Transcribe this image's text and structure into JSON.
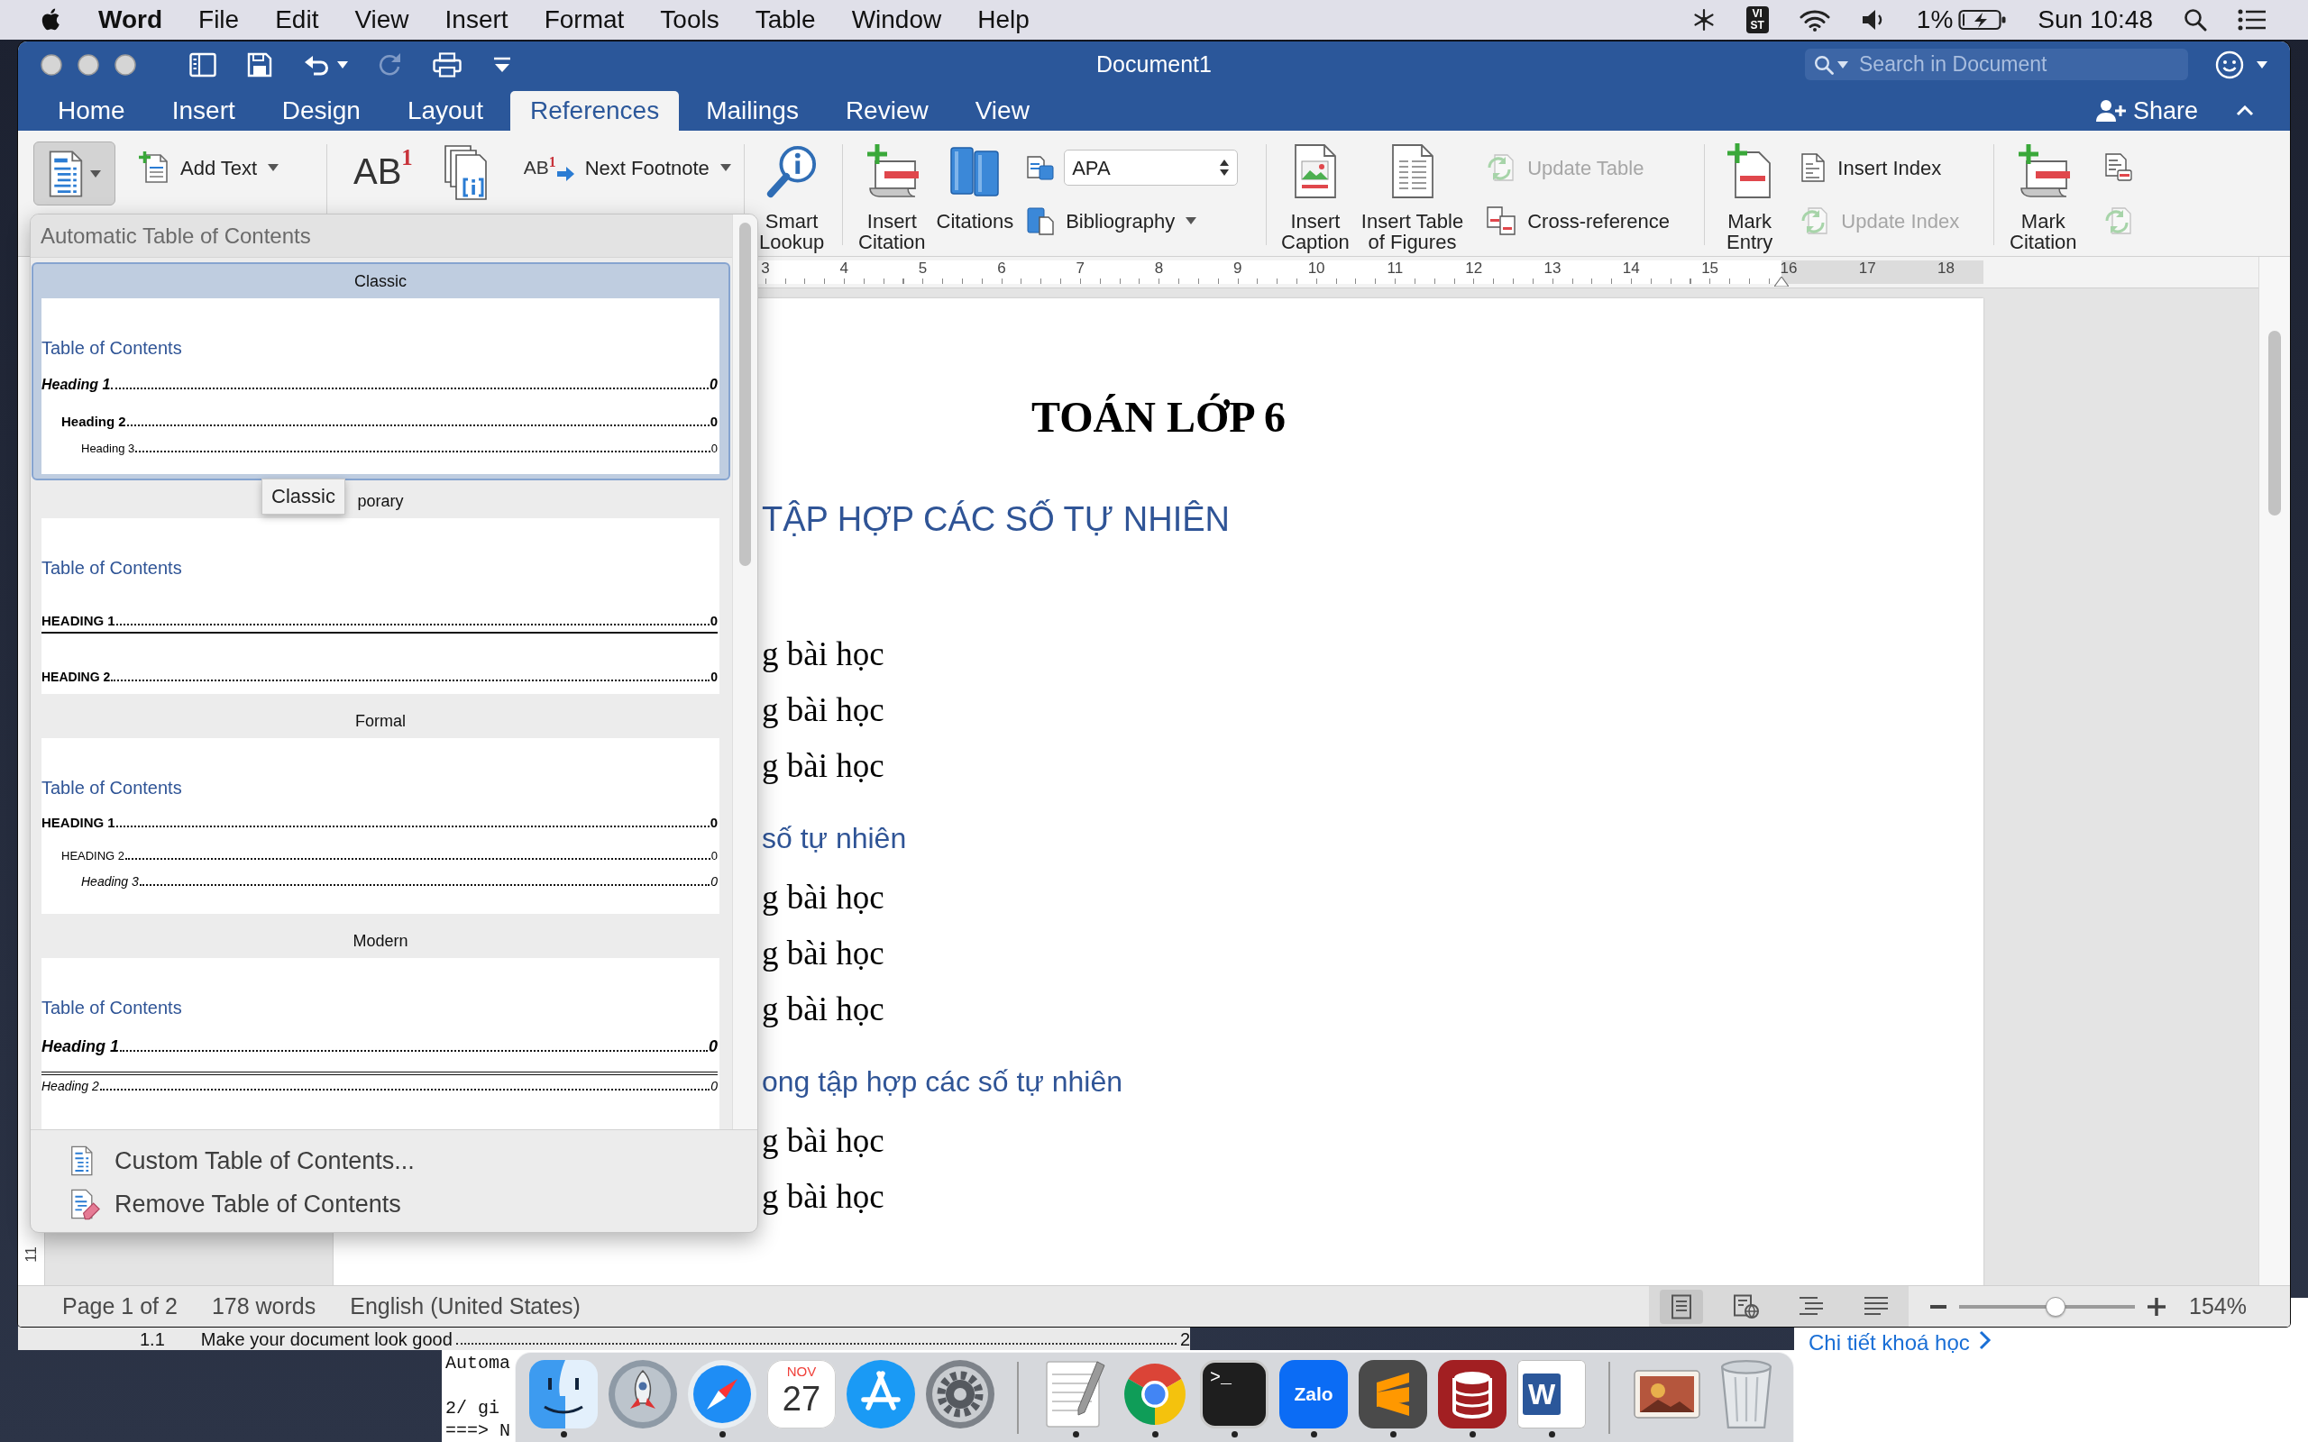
{
  "menu_bar": {
    "app": "Word",
    "items": [
      "File",
      "Edit",
      "View",
      "Insert",
      "Format",
      "Tools",
      "Table",
      "Window",
      "Help"
    ],
    "input_source": "VI\nST",
    "battery": "1%",
    "clock": "Sun 10:48"
  },
  "window": {
    "title": "Document1",
    "toolbar": [
      {
        "kind": "sidebar",
        "disabled": false
      },
      {
        "kind": "save",
        "disabled": false
      },
      {
        "kind": "undo",
        "disabled": false
      },
      {
        "kind": "redo",
        "disabled": true
      },
      {
        "kind": "print",
        "disabled": false
      },
      {
        "kind": "customize",
        "disabled": false
      }
    ],
    "search": {
      "placeholder": "Search in Document"
    },
    "share": "Share"
  },
  "tabs": [
    {
      "label": "Home",
      "selected": false
    },
    {
      "label": "Insert",
      "selected": false
    },
    {
      "label": "Design",
      "selected": false
    },
    {
      "label": "Layout",
      "selected": false
    },
    {
      "label": "References",
      "selected": true
    },
    {
      "label": "Mailings",
      "selected": false
    },
    {
      "label": "Review",
      "selected": false
    },
    {
      "label": "View",
      "selected": false
    }
  ],
  "ribbon": {
    "toc": {
      "expanded": true
    },
    "add_text": "Add Text",
    "footnote": "AB$^{1}$",
    "next_footnote": {
      "glyph": "AB$^{1}$",
      "label": "Next Footnote"
    },
    "smart_lookup": "Smart\nLookup",
    "insert_citation": "Insert\nCitation",
    "citations": "Citations",
    "style": {
      "value": "APA"
    },
    "bibliography": "Bibliography",
    "insert_caption": "Insert\nCaption",
    "table_of_figures": "Insert Table\nof Figures",
    "caption_tools": [
      {
        "kind": "update",
        "label": "Update Table",
        "disabled": true
      },
      {
        "kind": "crossref",
        "label": "Cross-reference",
        "disabled": false
      }
    ],
    "mark_entry": "Mark\nEntry",
    "index_tools": [
      {
        "kind": "index",
        "label": "Insert Index",
        "disabled": false
      },
      {
        "kind": "update",
        "label": "Update Index",
        "disabled": true
      }
    ],
    "mark_citation": "Mark\nCitation",
    "authorities_tools": [
      {
        "kind": "authorities",
        "disabled": false
      },
      {
        "kind": "update",
        "disabled": true
      }
    ]
  },
  "ruler": {
    "numbers": [
      "3",
      "4",
      "5",
      "6",
      "7",
      "8",
      "9",
      "10",
      "11",
      "12",
      "13",
      "14",
      "15",
      "16",
      "17",
      "18"
    ]
  },
  "vertical_ruler": {
    "numbers": [
      "11"
    ]
  },
  "document": {
    "blocks": [
      {
        "kind": "title",
        "text": "TOÁN LỚP 6"
      },
      {
        "kind": "heading1",
        "text": "TẬP HỢP CÁC SỐ TỰ NHIÊN"
      },
      {
        "kind": "body",
        "text": "g bài học"
      },
      {
        "kind": "body",
        "text": "g bài học"
      },
      {
        "kind": "body",
        "text": "g bài học"
      },
      {
        "kind": "heading2",
        "text": "số tự nhiên"
      },
      {
        "kind": "body",
        "text": "g bài học"
      },
      {
        "kind": "body",
        "text": "g bài học"
      },
      {
        "kind": "body",
        "text": "g bài học"
      },
      {
        "kind": "heading2",
        "text": "ong tập hợp các số tự nhiên"
      },
      {
        "kind": "body",
        "text": "g bài học"
      },
      {
        "kind": "body",
        "text": "g bài học"
      }
    ]
  },
  "toc_menu": {
    "header": "Automatic Table of Contents",
    "styles": [
      {
        "kind": "classic",
        "label": "Classic",
        "selected": true,
        "preview": {
          "title": "Table of Contents",
          "entries": [
            {
              "text": "Heading 1",
              "page": "0",
              "children": [
                {
                  "text": "Heading 2",
                  "page": "0",
                  "children": [
                    {
                      "text": "Heading 3",
                      "page": "0"
                    }
                  ]
                }
              ]
            }
          ]
        }
      },
      {
        "kind": "contemporary",
        "label": "porary",
        "selected": false,
        "preview": {
          "title": "Table of Contents",
          "entries": [
            {
              "text": "HEADING 1",
              "page": "0",
              "children": [
                {
                  "text": "HEADING 2",
                  "page": "0"
                }
              ]
            }
          ]
        }
      },
      {
        "kind": "formal",
        "label": "Formal",
        "selected": false,
        "preview": {
          "title": "Table of Contents",
          "entries": [
            {
              "text": "HEADING 1",
              "page": "0",
              "children": [
                {
                  "text": "HEADING 2",
                  "page": "0",
                  "children": [
                    {
                      "text": "Heading 3",
                      "page": "0"
                    }
                  ]
                }
              ]
            }
          ]
        }
      },
      {
        "kind": "modern",
        "label": "Modern",
        "selected": false,
        "preview": {
          "title": "Table of Contents",
          "entries": [
            {
              "text": "Heading 1",
              "page": "0",
              "children": [
                {
                  "text": "Heading 2",
                  "page": "0"
                }
              ]
            }
          ]
        }
      }
    ],
    "commands": [
      {
        "kind": "custom",
        "label": "Custom Table of Contents..."
      },
      {
        "kind": "remove",
        "label": "Remove Table of Contents"
      }
    ]
  },
  "tooltip": {
    "text": "Classic"
  },
  "status_bar": {
    "page": "Page 1 of 2",
    "words": "178 words",
    "language": "English (United States)",
    "views": [
      {
        "kind": "print",
        "selected": true
      },
      {
        "kind": "web",
        "selected": false
      },
      {
        "kind": "outline",
        "selected": false
      },
      {
        "kind": "draft",
        "selected": false
      }
    ],
    "zoom": {
      "level": 0.55,
      "reading": "154%"
    }
  },
  "dock": {
    "apps": [
      {
        "kind": "finder",
        "running": true
      },
      {
        "kind": "launchpad",
        "running": false
      },
      {
        "kind": "safari",
        "running": true
      },
      {
        "kind": "calendar",
        "running": false,
        "month": "NOV",
        "day": "27"
      },
      {
        "kind": "appstore",
        "running": false
      },
      {
        "kind": "settings",
        "running": false
      },
      {
        "kind": "divider"
      },
      {
        "kind": "textedit",
        "running": true
      },
      {
        "kind": "chrome",
        "running": true
      },
      {
        "kind": "terminal",
        "running": true,
        "glyph": ">_"
      },
      {
        "kind": "zalo",
        "running": true,
        "label": "Zalo"
      },
      {
        "kind": "sublime",
        "running": true
      },
      {
        "kind": "database",
        "running": true
      },
      {
        "kind": "word",
        "running": true,
        "glyph": "W"
      },
      {
        "kind": "divider"
      },
      {
        "kind": "photos",
        "running": false
      },
      {
        "kind": "trash",
        "running": false
      }
    ]
  },
  "background": {
    "document_line": {
      "number": "1.1",
      "text": "Make your document look good",
      "page": "2"
    },
    "terminal_lines": [
      "Automa",
      "2/ gi",
      "===> N"
    ],
    "link": "Chi tiết khoá học"
  }
}
